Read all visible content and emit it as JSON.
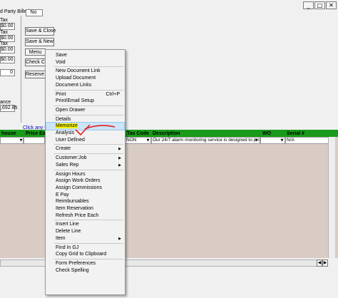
{
  "window_controls": [
    "_",
    "□",
    "✕"
  ],
  "header": {
    "party_billed_label": "d Party Billed",
    "party_billed_value": "No"
  },
  "tax_labels": [
    "Tax",
    "Tax",
    "Tax"
  ],
  "tax_values": [
    "$0.00",
    "$0.00",
    "$0.00",
    "$0.00"
  ],
  "misc_value": "0",
  "balance_label": "ance",
  "balance_value": ",692.85",
  "buttons": {
    "save_close": "Save & Close",
    "save_new": "Save & New",
    "menu": "Menu",
    "check": "Check C",
    "reserve": "Reserve I"
  },
  "grid": {
    "hint": "Click any Gre",
    "columns": [
      "house",
      "Price Each",
      "Tax Code",
      "Description",
      "WO",
      "Serial #"
    ],
    "row": {
      "tax_code": "NON",
      "description": "Our 24/7 alarm monitoring service is designed to provide p",
      "serial": "N/A"
    }
  },
  "menu": {
    "items": [
      {
        "label": "Save"
      },
      {
        "label": "Void"
      },
      {
        "sep": true
      },
      {
        "label": "New Document Link"
      },
      {
        "label": "Upload Document"
      },
      {
        "label": "Document Links"
      },
      {
        "sep": true
      },
      {
        "label": "Print",
        "shortcut": "Ctrl+P"
      },
      {
        "label": "Print/Email Setup"
      },
      {
        "sep": true
      },
      {
        "label": "Open Drawer"
      },
      {
        "sep": true
      },
      {
        "label": "Details"
      },
      {
        "label": "Memorize",
        "highlight": true
      },
      {
        "label": "Analysis"
      },
      {
        "label": "User Defined"
      },
      {
        "sep": true
      },
      {
        "label": "Create",
        "submenu": true
      },
      {
        "sep": true
      },
      {
        "label": "Customer:Job",
        "submenu": true
      },
      {
        "label": "Sales Rep",
        "submenu": true
      },
      {
        "sep": true
      },
      {
        "label": "Assign Hours"
      },
      {
        "label": "Assign Work Orders"
      },
      {
        "label": "Assign Commissions"
      },
      {
        "label": "E Pay"
      },
      {
        "label": "Reimbursables"
      },
      {
        "label": "Item Reservation"
      },
      {
        "label": "Refresh Price Each"
      },
      {
        "sep": true
      },
      {
        "label": "Insert Line"
      },
      {
        "label": "Delete Line"
      },
      {
        "label": "Item",
        "submenu": true
      },
      {
        "sep": true
      },
      {
        "label": "Find In GJ"
      },
      {
        "label": "Copy Grid to Clipboard"
      },
      {
        "sep": true
      },
      {
        "label": "Form Preferences"
      },
      {
        "label": "Check Spelling"
      }
    ],
    "arrow_glyph": "▶"
  },
  "colors": {
    "grid_header": "#1a9a1a",
    "grid_bg": "#d8ccc4",
    "menu_highlight": "#cce4f7",
    "annotation": "#e02020"
  }
}
